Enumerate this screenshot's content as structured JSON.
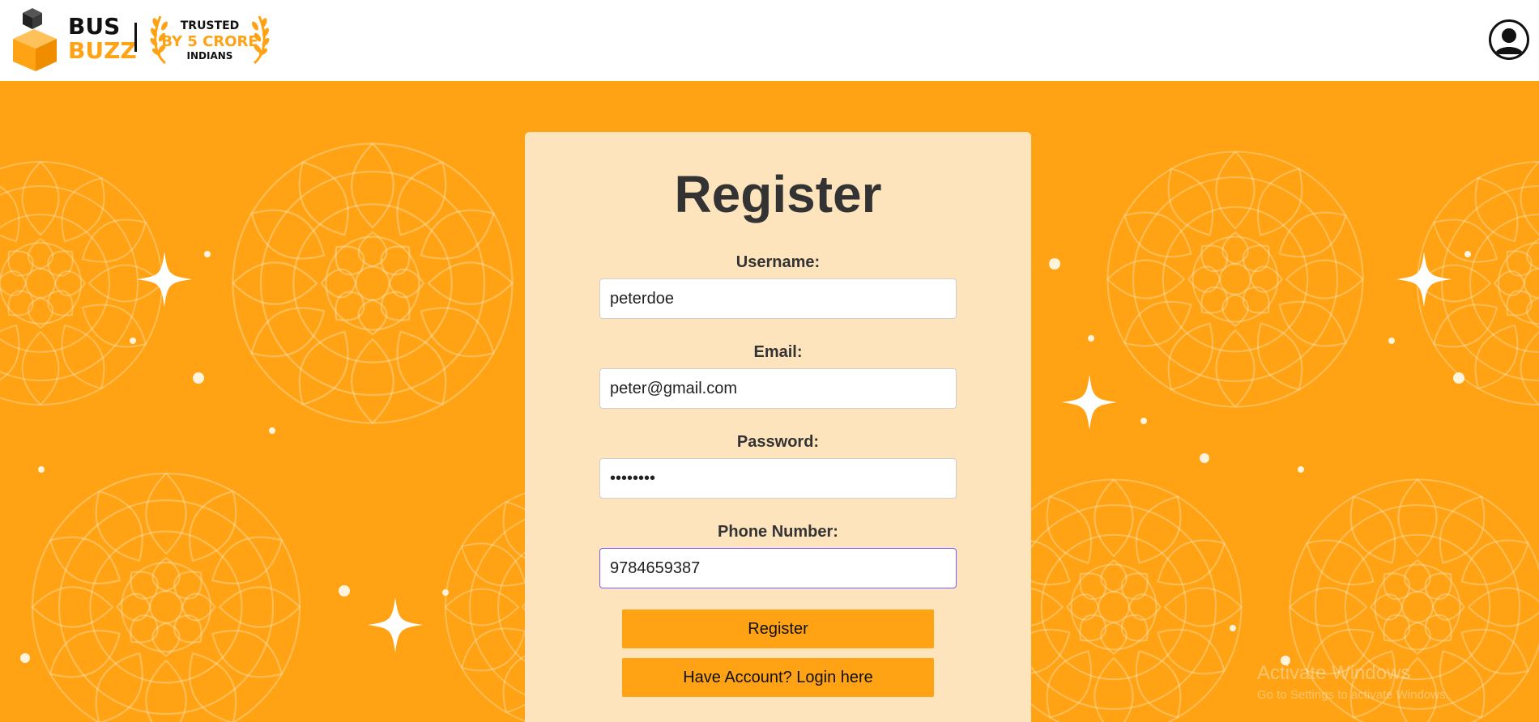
{
  "header": {
    "logo_line1": "BUS",
    "logo_line2": "BUZZ",
    "badge_line1": "TRUSTED",
    "badge_line2": "BY 5 CRORE",
    "badge_line3": "INDIANS",
    "avatar_icon": "user-avatar-icon"
  },
  "form": {
    "title": "Register",
    "username_label": "Username:",
    "username_value": "peterdoe",
    "email_label": "Email:",
    "email_value": "peter@gmail.com",
    "password_label": "Password:",
    "password_value": "password",
    "phone_label": "Phone Number:",
    "phone_value": "9784659387",
    "register_button": "Register",
    "login_button": "Have Account? Login here"
  },
  "watermark": {
    "line1": "Activate Windows",
    "line2": "Go to Settings to activate Windows."
  },
  "colors": {
    "accent": "#ffa213",
    "card": "#fee4bc",
    "text": "#333333"
  }
}
